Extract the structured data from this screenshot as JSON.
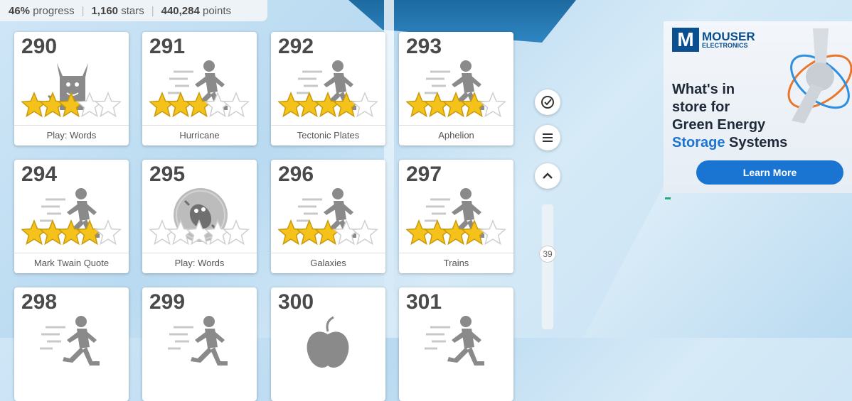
{
  "header": {
    "progress_value": "46%",
    "progress_label": "progress",
    "stars_value": "1,160",
    "stars_label": "stars",
    "points_value": "440,284",
    "points_label": "points"
  },
  "levels": [
    {
      "number": "290",
      "name": "Play: Words",
      "stars": 3,
      "max_stars": 5,
      "icon": "monster-icon"
    },
    {
      "number": "291",
      "name": "Hurricane",
      "stars": 3,
      "max_stars": 5,
      "icon": "runner-icon"
    },
    {
      "number": "292",
      "name": "Tectonic Plates",
      "stars": 4,
      "max_stars": 5,
      "icon": "runner-icon"
    },
    {
      "number": "293",
      "name": "Aphelion",
      "stars": 4,
      "max_stars": 5,
      "icon": "runner-icon"
    },
    {
      "number": "294",
      "name": "Mark Twain Quote",
      "stars": 4,
      "max_stars": 5,
      "icon": "runner-icon"
    },
    {
      "number": "295",
      "name": "Play: Words",
      "stars": 0,
      "max_stars": 5,
      "icon": "bubble-creature-icon"
    },
    {
      "number": "296",
      "name": "Galaxies",
      "stars": 3,
      "max_stars": 5,
      "icon": "runner-icon"
    },
    {
      "number": "297",
      "name": "Trains",
      "stars": 4,
      "max_stars": 5,
      "icon": "runner-icon"
    },
    {
      "number": "298",
      "name": "",
      "stars": 0,
      "max_stars": 5,
      "icon": "runner-icon"
    },
    {
      "number": "299",
      "name": "",
      "stars": 0,
      "max_stars": 5,
      "icon": "runner-icon"
    },
    {
      "number": "300",
      "name": "",
      "stars": 0,
      "max_stars": 5,
      "icon": "apple-icon"
    },
    {
      "number": "301",
      "name": "",
      "stars": 0,
      "max_stars": 5,
      "icon": "runner-icon"
    }
  ],
  "sidebar": {
    "buttons": [
      "check-circle-icon",
      "menu-icon",
      "chevron-up-icon"
    ],
    "scroll_value": "39"
  },
  "ad": {
    "brand_line1": "MOUSER",
    "brand_line2": "ELECTRONICS",
    "headline_line1": "What's in",
    "headline_line2": "store for",
    "headline_line3": "Green Energy",
    "headline_highlight": "Storage",
    "headline_rest": " Systems",
    "cta_label": "Learn More"
  },
  "colors": {
    "star_fill": "#f4c21b",
    "icon_gray": "#8a8a8a",
    "ad_blue": "#1a74d2",
    "ad_brand": "#0a4f8f"
  }
}
